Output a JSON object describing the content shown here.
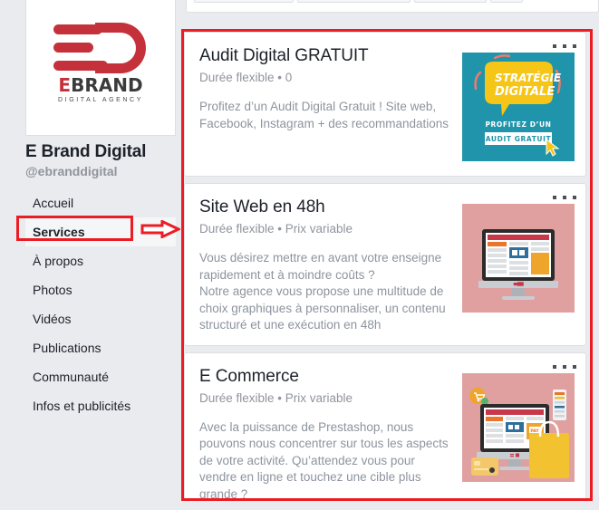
{
  "profile": {
    "logo": {
      "wordmark_red": "E",
      "wordmark_rest": "BRAND",
      "tagline": "DIGITAL AGENCY"
    },
    "name": "E Brand Digital",
    "handle": "@ebranddigital"
  },
  "nav": {
    "items": [
      {
        "label": "Accueil",
        "active": false
      },
      {
        "label": "Services",
        "active": true
      },
      {
        "label": "À propos",
        "active": false
      },
      {
        "label": "Photos",
        "active": false
      },
      {
        "label": "Vidéos",
        "active": false
      },
      {
        "label": "Publications",
        "active": false
      },
      {
        "label": "Communauté",
        "active": false
      },
      {
        "label": "Infos et publicités",
        "active": false
      }
    ]
  },
  "annotations": {
    "highlight_color": "#ec1c24",
    "services_box": "services-highlight-box",
    "arrow": "right-arrow-pointing-to-services-panel",
    "panel_box": "services-panel-highlight-box"
  },
  "services": [
    {
      "title": "Audit Digital GRATUIT",
      "meta": "Durée flexible • 0",
      "description": "Profitez d’un Audit Digital Gratuit ! Site web, Facebook, Instagram + des recommandations",
      "menu_icon": "more-options-icon",
      "thumb": {
        "name": "audit-digital-thumbnail",
        "bg": "#2094ab",
        "bubble": "#f5c518",
        "line1": "STRATÉGIE",
        "line2": "DIGITALE",
        "caption": "PROFITEZ D’UN",
        "button": "AUDIT GRATUIT"
      }
    },
    {
      "title": "Site Web en 48h",
      "meta": "Durée flexible • Prix variable",
      "description": "Vous désirez mettre en avant votre enseigne rapidement et à moindre coûts ?\nNotre agence vous propose une multitude de choix graphiques à personnaliser, un contenu structuré et une exécution en 48h",
      "menu_icon": "more-options-icon",
      "thumb": {
        "name": "site-web-thumbnail",
        "bg": "#e0a0a0",
        "accent_red": "#c8384a",
        "accent_orange": "#e8762c",
        "accent_blue": "#2e6f9e",
        "accent_yellow": "#efa52b"
      }
    },
    {
      "title": "E Commerce",
      "meta": "Durée flexible • Prix variable",
      "description": "Avec la puissance de Prestashop, nous pouvons nous concentrer sur tous les aspects de votre activité. Qu’attendez vous pour vendre en ligne et touchez une cible plus grande ?",
      "menu_icon": "more-options-icon",
      "thumb": {
        "name": "e-commerce-thumbnail",
        "bg": "#e0a0a0",
        "accent_red": "#c8384a",
        "accent_orange": "#e8762c",
        "accent_blue": "#2e6f9e",
        "accent_yellow": "#efc02b",
        "bag": "#f2c230"
      }
    }
  ]
}
